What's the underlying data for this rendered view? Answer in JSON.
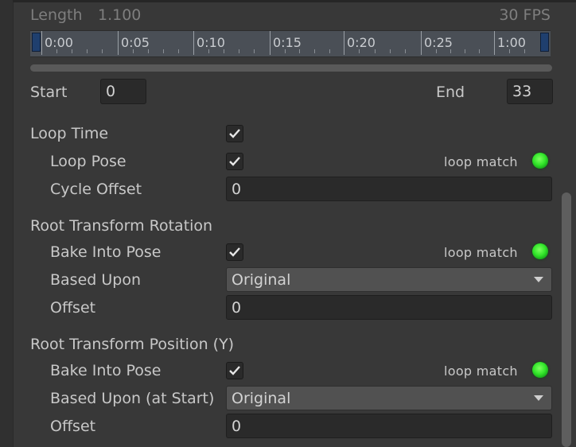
{
  "header": {
    "length_label": "Length",
    "length_value": "1.100",
    "fps": "30 FPS"
  },
  "timeline": {
    "ticks": [
      "0:00",
      "0:05",
      "0:10",
      "0:15",
      "0:20",
      "0:25",
      "1:00"
    ]
  },
  "range": {
    "start_label": "Start",
    "start_value": "0",
    "end_label": "End",
    "end_value": "33"
  },
  "loop_time": {
    "label": "Loop Time",
    "checked": true,
    "loop_pose": {
      "label": "Loop Pose",
      "checked": true,
      "match_label": "loop match"
    },
    "cycle_offset": {
      "label": "Cycle Offset",
      "value": "0"
    }
  },
  "root_rotation": {
    "title": "Root Transform Rotation",
    "bake": {
      "label": "Bake Into Pose",
      "checked": true,
      "match_label": "loop match"
    },
    "based_upon": {
      "label": "Based Upon",
      "value": "Original"
    },
    "offset": {
      "label": "Offset",
      "value": "0"
    }
  },
  "root_position_y": {
    "title": "Root Transform Position (Y)",
    "bake": {
      "label": "Bake Into Pose",
      "checked": true,
      "match_label": "loop match"
    },
    "based_upon": {
      "label": "Based Upon (at Start)",
      "value": "Original"
    },
    "offset": {
      "label": "Offset",
      "value": "0"
    }
  },
  "colors": {
    "background": "#383838",
    "field": "#2a2a2a",
    "timeline": "#4a4f56",
    "indicator_green": "#33e62a"
  },
  "icons": {
    "checkbox": "checkmark-icon",
    "indicator": "green-dot-icon",
    "dropdown": "chevron-down-icon"
  }
}
